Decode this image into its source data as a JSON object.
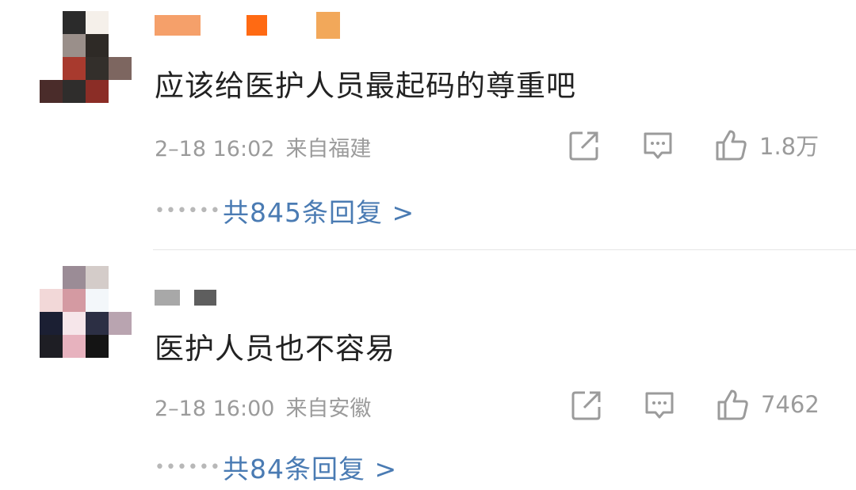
{
  "comments": [
    {
      "text": "应该给医护人员最起码的尊重吧",
      "date": "2–18 16:02",
      "location": "来自福建",
      "likes": "1.8万",
      "replies_label": "共845条回复 >",
      "avatar_colors": [
        "#ffffff",
        "#2b2b2b",
        "#f5f0ea",
        "#ffffff",
        "#ffffff",
        "#9a8f8a",
        "#2e2a26",
        "#ffffff",
        "#ffffff",
        "#a83a2e",
        "#332f2b",
        "#7d6660",
        "#4a2c2a",
        "#2f2d2c",
        "#8b2d26",
        "#ffffff"
      ],
      "name_colors": [
        "#f5a06a",
        "#ff6a13",
        "#f2a85a"
      ]
    },
    {
      "text": "医护人员也不容易",
      "date": "2–18 16:00",
      "location": "来自安徽",
      "likes": "7462",
      "replies_label": "共84条回复 >",
      "avatar_colors": [
        "#ffffff",
        "#9b8c96",
        "#d4ccc9",
        "#ffffff",
        "#f2d8d8",
        "#d49aa2",
        "#f3f7fa",
        "#ffffff",
        "#1b1f33",
        "#f6e6ea",
        "#2c2f44",
        "#b9a4b0",
        "#1e1e24",
        "#e7b2be",
        "#141414",
        "#ffffff"
      ],
      "name_colors": [
        "#a8a8a8",
        "#5e5e5e"
      ]
    }
  ],
  "icons": {
    "share": "share-icon",
    "comment": "comment-icon",
    "like": "like-icon",
    "more": "ellipsis-icon"
  }
}
